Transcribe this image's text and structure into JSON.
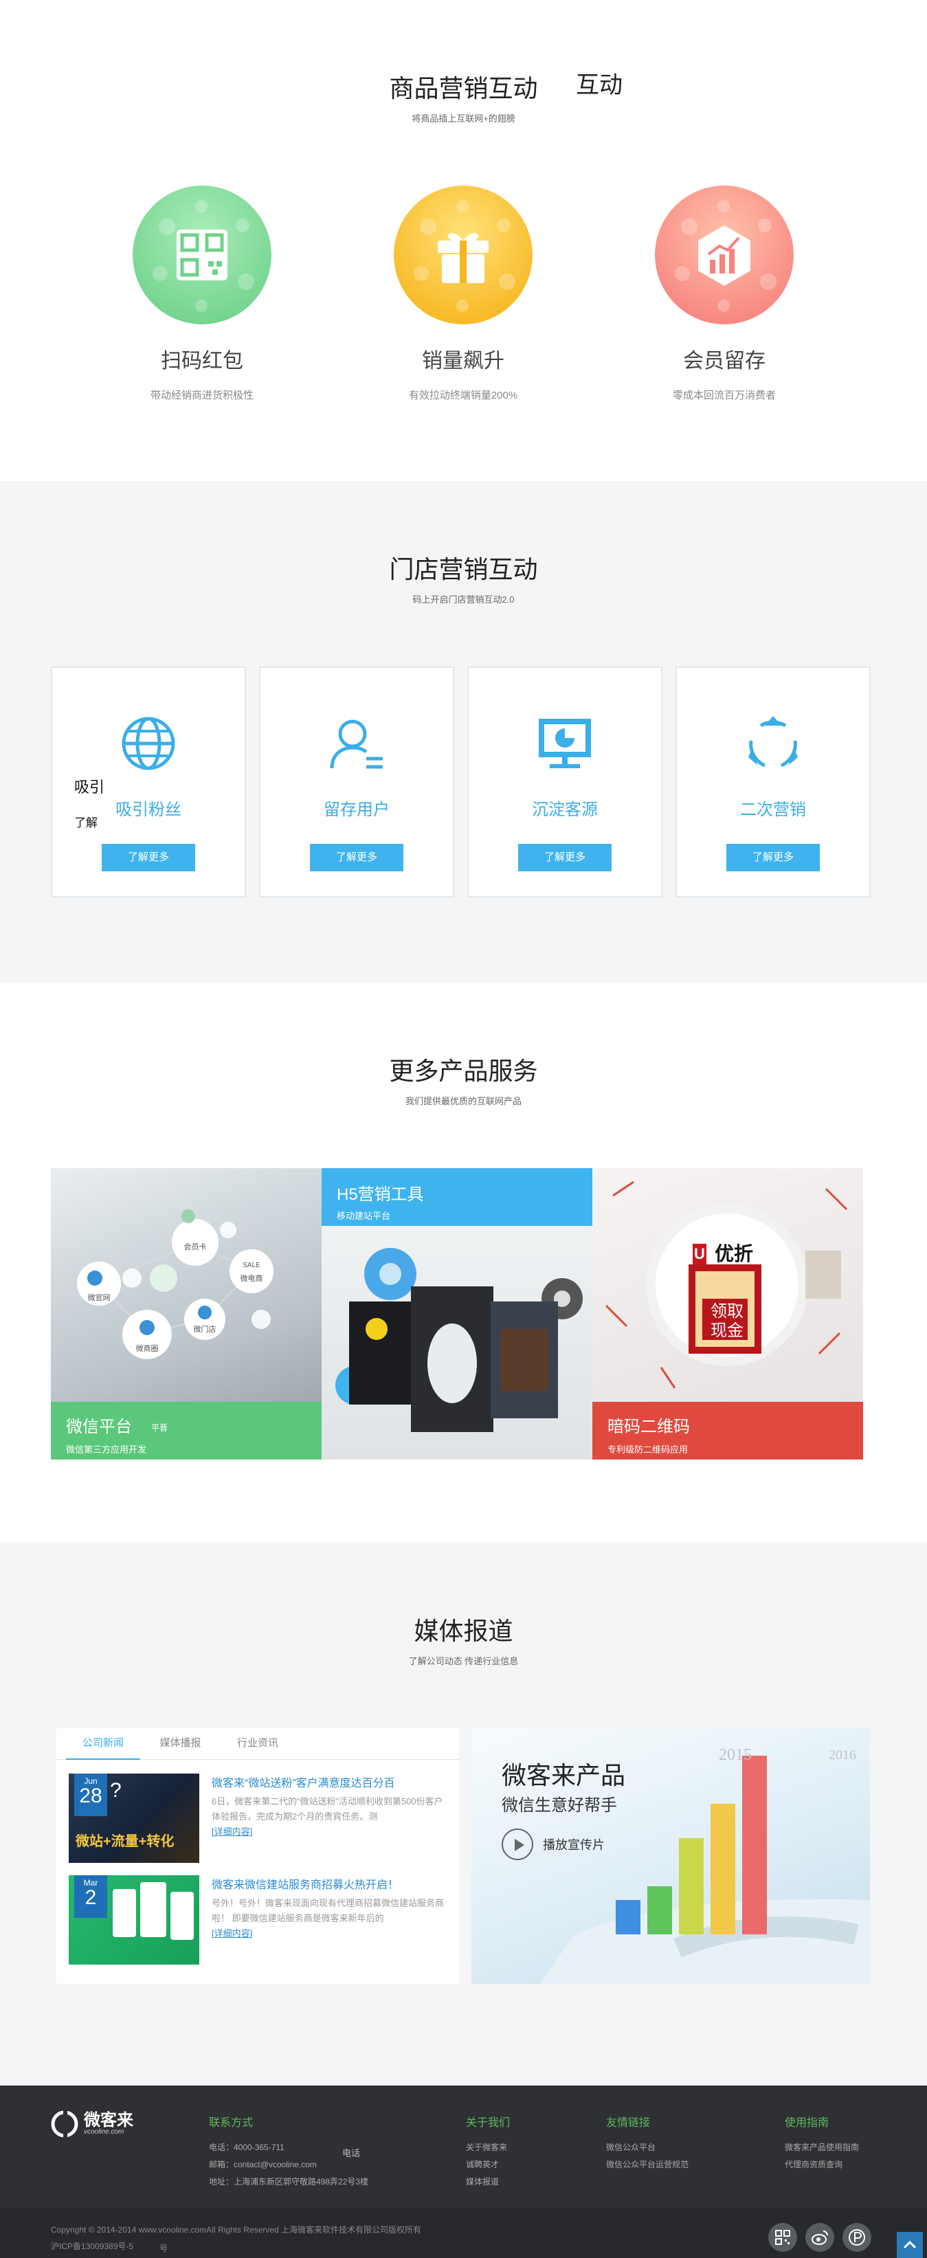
{
  "s1": {
    "title": "商品营销互动",
    "stray_text": "互动",
    "subtitle": "将商品插上互联网+的翅膀",
    "items": [
      {
        "title": "扫码红包",
        "desc": "带动经销商进货积极性",
        "icon": "qr-code-icon"
      },
      {
        "title": "销量飙升",
        "desc": "有效拉动终端销量200%",
        "icon": "gift-icon"
      },
      {
        "title": "会员留存",
        "desc": "零成本回流百万消费者",
        "icon": "growth-chart-icon"
      }
    ],
    "colors": {
      "green": "#7ed99a",
      "yellow": "#fbc02d",
      "pink": "#f88a82"
    }
  },
  "s2": {
    "title": "门店营销互动",
    "subtitle": "码上开启门店营销互动2.0",
    "stray_a": "吸引",
    "stray_b": "了解",
    "cards": [
      {
        "label": "吸引粉丝",
        "button": "了解更多",
        "icon": "globe-icon"
      },
      {
        "label": "留存用户",
        "button": "了解更多",
        "icon": "user-icon"
      },
      {
        "label": "沉淀客源",
        "button": "了解更多",
        "icon": "monitor-chart-icon"
      },
      {
        "label": "二次营销",
        "button": "了解更多",
        "icon": "cycle-icon"
      }
    ],
    "accent": "#3fb3ee"
  },
  "s3": {
    "title": "更多产品服务",
    "subtitle": "我们提供最优质的互联网产品",
    "products": [
      {
        "title": "微信平台",
        "extra": "平晋",
        "desc": "微信第三方应用开发",
        "bubbles": [
          "会员卡",
          "微官网",
          "微电商",
          "微门店",
          "微商圈"
        ],
        "sale": "SALE",
        "color": "#5bc77a"
      },
      {
        "title": "H5营销工具",
        "desc": "移动建站平台",
        "color": "#3fb3ee"
      },
      {
        "title": "暗码二维码",
        "desc": "专利级防二维码应用",
        "coupon": {
          "brand": "优折",
          "line1": "领取",
          "line2": "现金"
        },
        "color": "#e04a3e"
      }
    ]
  },
  "s4": {
    "title": "媒体报道",
    "subtitle": "了解公司动态 传递行业信息",
    "tabs": [
      "公司新闻",
      "媒体播报",
      "行业资讯"
    ],
    "news": [
      {
        "month": "Jun",
        "day": "28",
        "title": "微客来“微站送粉”客户满意度达百分百",
        "body": "6日，微客来第二代的“微站送粉”活动顺利收到第500份客户体验报告，完成为期2个月的贵宾任务。测",
        "more": "[详细内容]",
        "thumb_text": "微站+流量+转化"
      },
      {
        "month": "Mar",
        "day": "2",
        "title": "微客来微信建站服务商招募火热开启！",
        "body": "号外！号外！微客来现面向现有代理商招募微信建站服务商啦！ 即要微信建站服务商是微客来新年后的",
        "more": "[详细内容]"
      }
    ],
    "banner": {
      "title": "微客来产品",
      "subtitle": "微信生意好帮手",
      "play": "播放宣传片",
      "years": [
        "2015",
        "2016"
      ]
    }
  },
  "footer": {
    "logo_name": "微客来",
    "logo_sub": "vcooline.com",
    "contact": {
      "heading": "联系方式",
      "lines": [
        "电话：4000-365-711",
        "邮箱：contact@vcooline.com",
        "地址：上海浦东新区郭守敬路498弄22号3楼"
      ]
    },
    "stray": "电话",
    "about": {
      "heading": "关于我们",
      "links": [
        "关于微客来",
        "诚聘英才",
        "媒体报道"
      ]
    },
    "friends": {
      "heading": "友情链接",
      "links": [
        "微信公众平台",
        "微信公众平台运营规范"
      ]
    },
    "guide": {
      "heading": "使用指南",
      "links": [
        "微客来产品使用指南",
        "代理商资质查询"
      ]
    },
    "copyright": "Copyright © 2014-2014 www.vcooline.comAll Rights Reserved 上海微客来软件技术有限公司版权所有",
    "icp": "沪ICP备13009389号-5",
    "icp_stray": "号",
    "social": [
      "qr-code-icon",
      "weibo-icon",
      "p-icon"
    ]
  }
}
